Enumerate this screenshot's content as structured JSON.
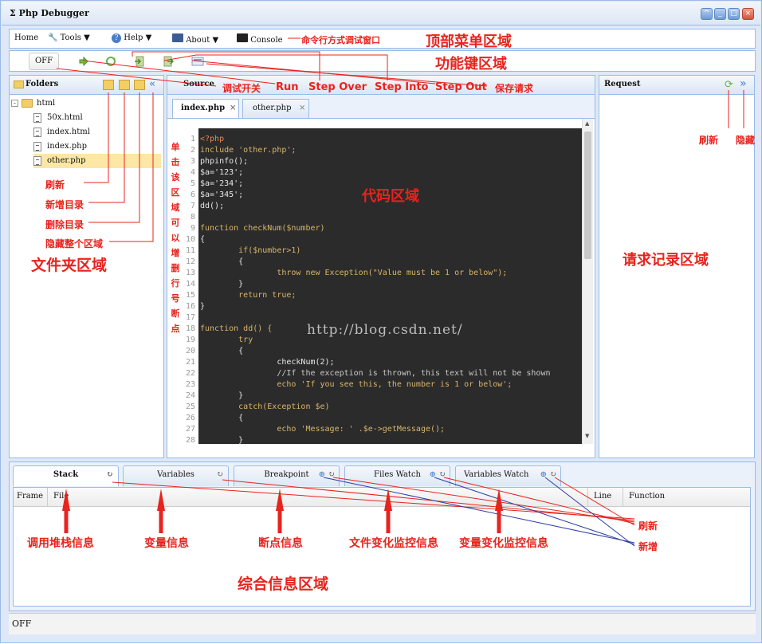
{
  "window": {
    "title": "Php Debugger",
    "title_glyph": "Σ"
  },
  "menu": {
    "items": [
      {
        "label": "Home"
      },
      {
        "label": "Tools",
        "icon": "wrench-icon"
      },
      {
        "label": "Help",
        "icon": "help-icon"
      },
      {
        "label": "About",
        "icon": "book-icon"
      },
      {
        "label": "Console",
        "icon": "console-icon"
      }
    ]
  },
  "toolbar": {
    "off_label": "OFF"
  },
  "folders": {
    "title": "Folders",
    "tree": [
      {
        "label": "html",
        "type": "folder"
      },
      {
        "label": "50x.html",
        "type": "file"
      },
      {
        "label": "index.html",
        "type": "file"
      },
      {
        "label": "index.php",
        "type": "file"
      },
      {
        "label": "other.php",
        "type": "file",
        "selected": true
      }
    ]
  },
  "source": {
    "title": "Source",
    "tabs": [
      {
        "label": "index.php",
        "close": "×",
        "active": true
      },
      {
        "label": "other.php",
        "close": "×",
        "active": false
      }
    ],
    "lines": [
      "<?php",
      "include 'other.php';",
      "phpinfo();",
      "$a='123';",
      "$a='234';",
      "$a='345';",
      "dd();",
      "",
      "function checkNum($number)",
      "{",
      "        if($number>1)",
      "        {",
      "                throw new Exception(\"Value must be 1 or below\");",
      "        }",
      "        return true;",
      "}",
      "",
      "function dd() {",
      "        try",
      "        {",
      "                checkNum(2);",
      "                //If the exception is thrown, this text will not be shown",
      "                echo 'If you see this, the number is 1 or below';",
      "        }",
      "        catch(Exception $e)",
      "        {",
      "                echo 'Message: ' .$e->getMessage();",
      "        }"
    ],
    "line_numbers": [
      "1",
      "2",
      "3",
      "4",
      "5",
      "6",
      "7",
      "8",
      "9",
      "10",
      "11",
      "12",
      "13",
      "14",
      "15",
      "16",
      "17",
      "18",
      "19",
      "20",
      "21",
      "22",
      "23",
      "24",
      "25",
      "26",
      "27",
      "28"
    ],
    "watermark": "http://blog.csdn.net/"
  },
  "request": {
    "title": "Request"
  },
  "bottom": {
    "tabs": [
      {
        "label": "Stack",
        "active": true
      },
      {
        "label": "Variables"
      },
      {
        "label": "Breakpoint"
      },
      {
        "label": "Files Watch"
      },
      {
        "label": "Variables Watch"
      }
    ],
    "columns": [
      "Frame",
      "File",
      "Line",
      "Function"
    ]
  },
  "status": {
    "text": "OFF"
  },
  "annotations": {
    "top_menu_area": "顶部菜单区域",
    "console_note": "命令行方式调试窗口",
    "function_keys_area": "功能键区域",
    "debug_switch": "调试开关",
    "run": "Run",
    "step_over": "Step Over",
    "step_into": "Step Into",
    "step_out": "Step Out",
    "save_request": "保存请求",
    "folder_refresh": "刷新",
    "new_dir": "新增目录",
    "delete_dir": "删除目录",
    "hide_area": "隐藏整个区域",
    "folder_area": "文件夹区域",
    "breakpoint_hint": "单击该区域可以增删行号断点",
    "code_area": "代码区域",
    "req_refresh": "刷新",
    "req_hide": "隐藏",
    "request_area": "请求记录区域",
    "stack_info": "调用堆栈信息",
    "var_info": "变量信息",
    "bp_info": "断点信息",
    "file_watch_info": "文件变化监控信息",
    "var_watch_info": "变量变化监控信息",
    "bottom_refresh": "刷新",
    "bottom_add": "新增",
    "summary_area": "综合信息区域"
  },
  "colors": {
    "annotation": "#e8231e",
    "frame": "#99bbe8",
    "code_bg": "#2b2b2b"
  }
}
